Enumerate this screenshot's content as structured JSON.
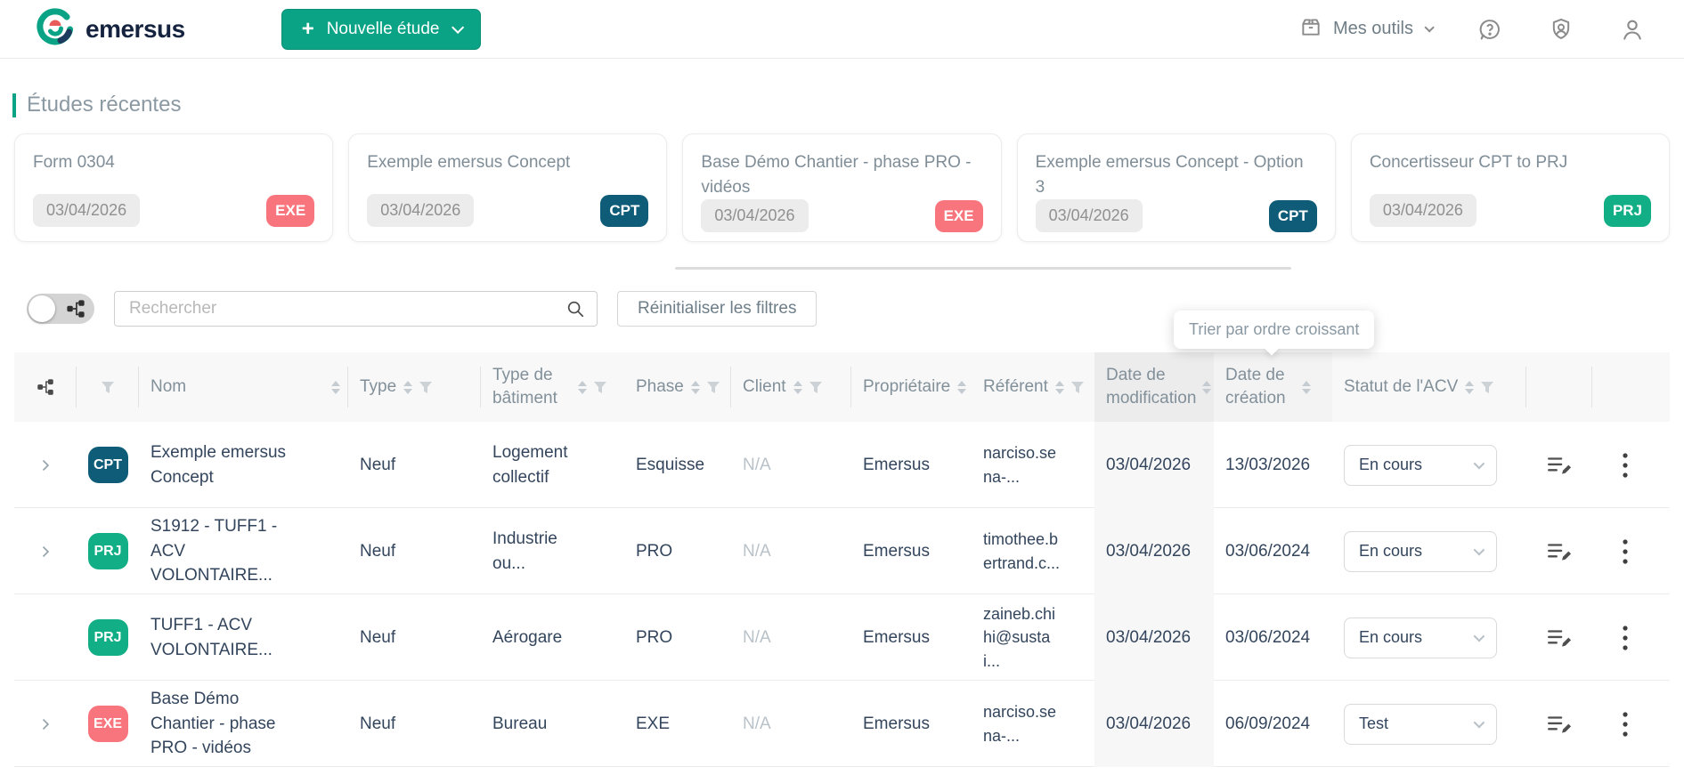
{
  "topbar": {
    "brand": "emersus",
    "new_study_button": "Nouvelle étude",
    "my_tools_label": "Mes outils"
  },
  "recent_section": {
    "title": "Études récentes",
    "cards": [
      {
        "title": "Form 0304",
        "date": "03/04/2026",
        "badge": "EXE",
        "badge_color": "#f8757d"
      },
      {
        "title": "Exemple emersus Concept",
        "date": "03/04/2026",
        "badge": "CPT",
        "badge_color": "#0e5c78"
      },
      {
        "title": "Base Démo Chantier - phase PRO - vidéos",
        "date": "03/04/2026",
        "badge": "EXE",
        "badge_color": "#f8757d"
      },
      {
        "title": "Exemple emersus Concept - Option 3",
        "date": "03/04/2026",
        "badge": "CPT",
        "badge_color": "#0e5c78"
      },
      {
        "title": "Concertisseur CPT to PRJ",
        "date": "03/04/2026",
        "badge": "PRJ",
        "badge_color": "#12ae85"
      }
    ]
  },
  "filter_bar": {
    "search_placeholder": "Rechercher",
    "reset_filters_label": "Réinitialiser les filtres"
  },
  "tooltip": {
    "text": "Trier par ordre croissant"
  },
  "table": {
    "headers": {
      "name": "Nom",
      "type": "Type",
      "building_type": "Type de bâtiment",
      "phase": "Phase",
      "client": "Client",
      "owner": "Propriétaire",
      "referent": "Référent",
      "date_modified": "Date de modification",
      "date_created": "Date de création",
      "acv_status": "Statut de l'ACV"
    },
    "rows": [
      {
        "badge": "CPT",
        "badge_color": "#0e5c78",
        "name": "Exemple emersus Concept",
        "type": "Neuf",
        "building_type": "Logement collectif",
        "phase": "Esquisse",
        "client": "N/A",
        "owner": "Emersus",
        "referent": "narciso.sena-...",
        "date_modified": "03/04/2026",
        "date_created": "13/03/2026",
        "status": "En cours"
      },
      {
        "badge": "PRJ",
        "badge_color": "#12ae85",
        "name": "S1912 - TUFF1 - ACV VOLONTAIRE...",
        "type": "Neuf",
        "building_type": "Industrie ou...",
        "phase": "PRO",
        "client": "N/A",
        "owner": "Emersus",
        "referent": "timothee.bertrand.c...",
        "date_modified": "03/04/2026",
        "date_created": "03/06/2024",
        "status": "En cours"
      },
      {
        "badge": "PRJ",
        "badge_color": "#12ae85",
        "name": "TUFF1 - ACV VOLONTAIRE...",
        "type": "Neuf",
        "building_type": "Aérogare",
        "phase": "PRO",
        "client": "N/A",
        "owner": "Emersus",
        "referent": "zaineb.chihi@sustai...",
        "date_modified": "03/04/2026",
        "date_created": "03/06/2024",
        "status": "En cours"
      },
      {
        "badge": "EXE",
        "badge_color": "#f8757d",
        "name": "Base Démo Chantier - phase PRO - vidéos",
        "type": "Neuf",
        "building_type": "Bureau",
        "phase": "EXE",
        "client": "N/A",
        "owner": "Emersus",
        "referent": "narciso.sena-...",
        "date_modified": "03/04/2026",
        "date_created": "06/09/2024",
        "status": "Test"
      }
    ]
  },
  "colors": {
    "accent": "#0aa385",
    "badge_cpt": "#0e5c78",
    "badge_prj": "#12ae85",
    "badge_exe": "#f8757d",
    "highlight_column": "#ececec"
  }
}
